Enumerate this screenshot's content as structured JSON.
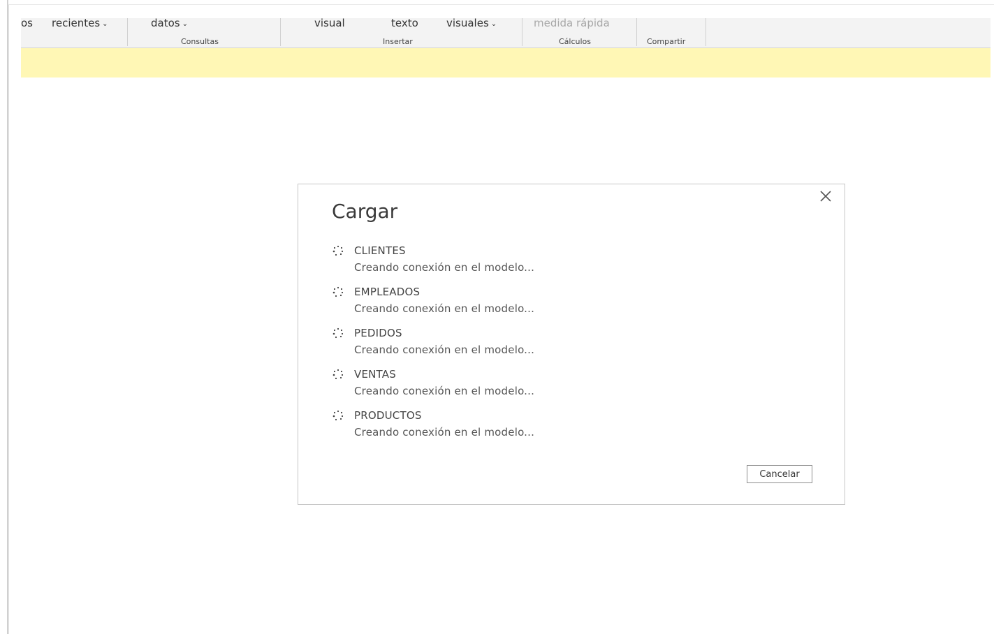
{
  "ribbon": {
    "items": [
      {
        "label": "os",
        "chevron": false,
        "disabled": false
      },
      {
        "label": "recientes",
        "chevron": true,
        "disabled": false
      },
      {
        "label": "datos",
        "chevron": true,
        "disabled": false
      },
      {
        "label": "visual",
        "chevron": false,
        "disabled": false
      },
      {
        "label": "texto",
        "chevron": false,
        "disabled": false
      },
      {
        "label": "visuales",
        "chevron": true,
        "disabled": false
      },
      {
        "label": "medida rápida",
        "chevron": false,
        "disabled": true
      }
    ],
    "groups": {
      "consultas": "Consultas",
      "insertar": "Insertar",
      "calculos": "Cálculos",
      "compartir": "Compartir"
    }
  },
  "notice_bar": {
    "color": "#fff7b5"
  },
  "dialog": {
    "title": "Cargar",
    "items": [
      {
        "name": "CLIENTES",
        "status": "Creando conexión en el modelo..."
      },
      {
        "name": "EMPLEADOS",
        "status": "Creando conexión en el modelo..."
      },
      {
        "name": "PEDIDOS",
        "status": "Creando conexión en el modelo..."
      },
      {
        "name": "VENTAS",
        "status": "Creando conexión en el modelo..."
      },
      {
        "name": "PRODUCTOS",
        "status": "Creando conexión en el modelo..."
      }
    ],
    "cancel_label": "Cancelar",
    "close_icon": "close-icon",
    "spinner_icon": "loading-spinner-icon"
  }
}
